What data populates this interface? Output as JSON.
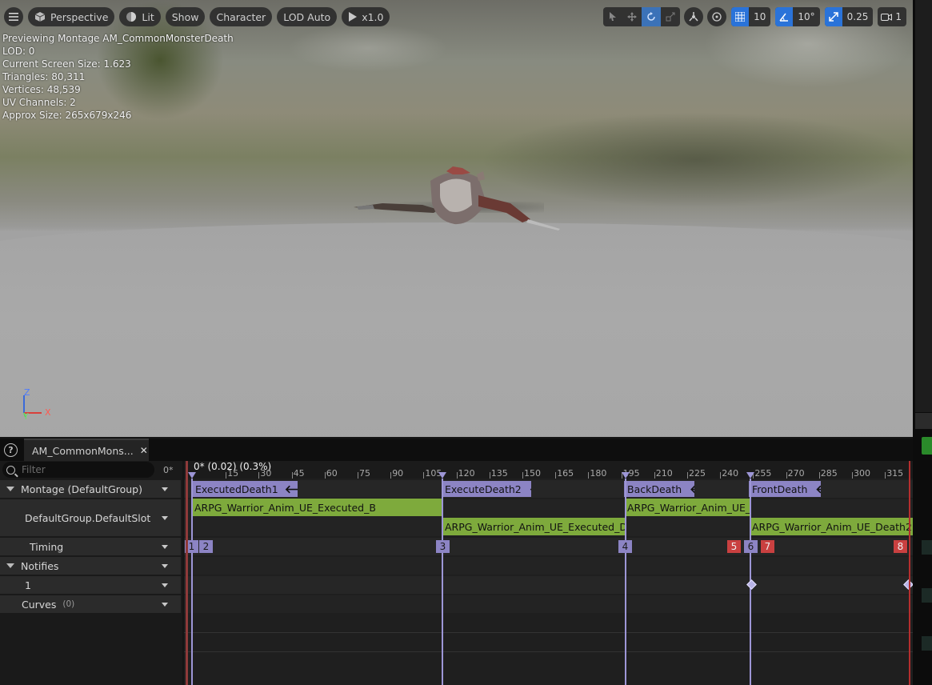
{
  "viewport": {
    "toolbar": {
      "perspective_label": "Perspective",
      "lit_label": "Lit",
      "show_label": "Show",
      "character_label": "Character",
      "lod_label": "LOD Auto",
      "speed_label": "x1.0",
      "grid_snap_value": "10",
      "rotation_snap_value": "10°",
      "scale_snap_value": "0.25",
      "camera_speed_value": "1"
    },
    "stats": {
      "previewing": "Previewing Montage AM_CommonMonsterDeath",
      "lod": "LOD: 0",
      "screen_size": "Current Screen Size: 1.623",
      "triangles": "Triangles: 80,311",
      "vertices": "Vertices: 48,539",
      "uv_channels": "UV Channels: 2",
      "approx_size": "Approx Size: 265x679x246"
    },
    "axis": {
      "z": "Z",
      "y": "Y",
      "x": "X"
    }
  },
  "panel": {
    "tab_title": "AM_CommonMons...",
    "filter_placeholder": "Filter",
    "filter_count": "0*",
    "tree": {
      "montage": "Montage (DefaultGroup)",
      "slot": "DefaultGroup.DefaultSlot",
      "timing": "Timing",
      "notifies": "Notifies",
      "notify_track": "1",
      "curves": "Curves",
      "curves_count": "(0)"
    },
    "timeline": {
      "current_frame": "0* (0.02) (0.3%)",
      "ticks": [
        "15",
        "30",
        "45",
        "60",
        "75",
        "90",
        "105",
        "120",
        "135",
        "150",
        "165",
        "180",
        "195",
        "210",
        "225",
        "240",
        "255",
        "270",
        "285",
        "300",
        "315"
      ],
      "sections": [
        "ExecutedDeath1",
        "ExecuteDeath2",
        "BackDeath",
        "FrontDeath"
      ],
      "clips": [
        "ARPG_Warrior_Anim_UE_Executed_B",
        "ARPG_Warrior_Anim_UE_Executed_Dea",
        "ARPG_Warrior_Anim_UE_D",
        "ARPG_Warrior_Anim_UE_Death2"
      ],
      "timing": [
        "1",
        "2",
        "3",
        "4",
        "5",
        "6",
        "7",
        "8"
      ]
    }
  }
}
